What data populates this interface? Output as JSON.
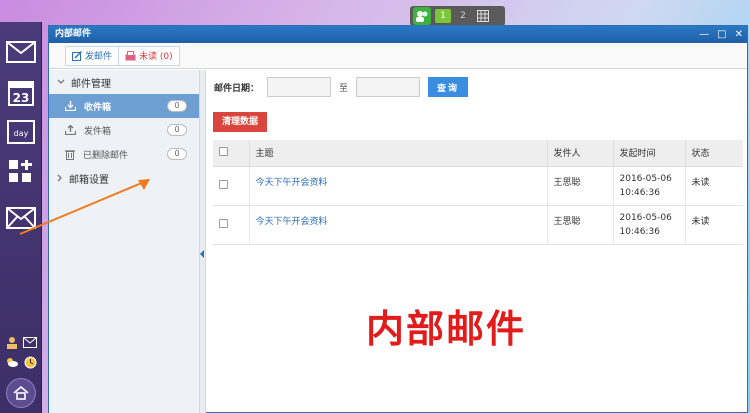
{
  "desktop_switcher": {
    "pages": [
      "1",
      "2"
    ],
    "active": "1"
  },
  "window": {
    "title": "内部邮件",
    "controls": [
      "—",
      "□",
      "✕"
    ]
  },
  "toolbar": {
    "compose_label": "发邮件",
    "unread_label": "未读 (0)"
  },
  "sidebar": {
    "group1_title": "邮件管理",
    "items": [
      {
        "label": "收件箱",
        "count": "0"
      },
      {
        "label": "发件箱",
        "count": "0"
      },
      {
        "label": "已删除邮件",
        "count": "0"
      }
    ],
    "group2_title": "邮箱设置"
  },
  "filter": {
    "date_label": "邮件日期：",
    "to_label": "至",
    "query_label": "查询"
  },
  "clear_label": "清理数据",
  "table": {
    "headers": [
      "主题",
      "发件人",
      "发起时间",
      "状态"
    ],
    "rows": [
      {
        "subject": "今天下午开会资料",
        "sender": "王思聪",
        "date": "2016-05-06",
        "time": "10:46:36",
        "status": "未读"
      },
      {
        "subject": "今天下午开会资料",
        "sender": "王思聪",
        "date": "2016-05-06",
        "time": "10:46:36",
        "status": "未读"
      }
    ]
  },
  "overlay_caption": "内部邮件",
  "colors": {
    "accent": "#2a6fb6",
    "titlebar": "#2b78c5",
    "danger": "#d9463e",
    "dock": "#3c2e66",
    "arrow": "#f07a1f"
  }
}
